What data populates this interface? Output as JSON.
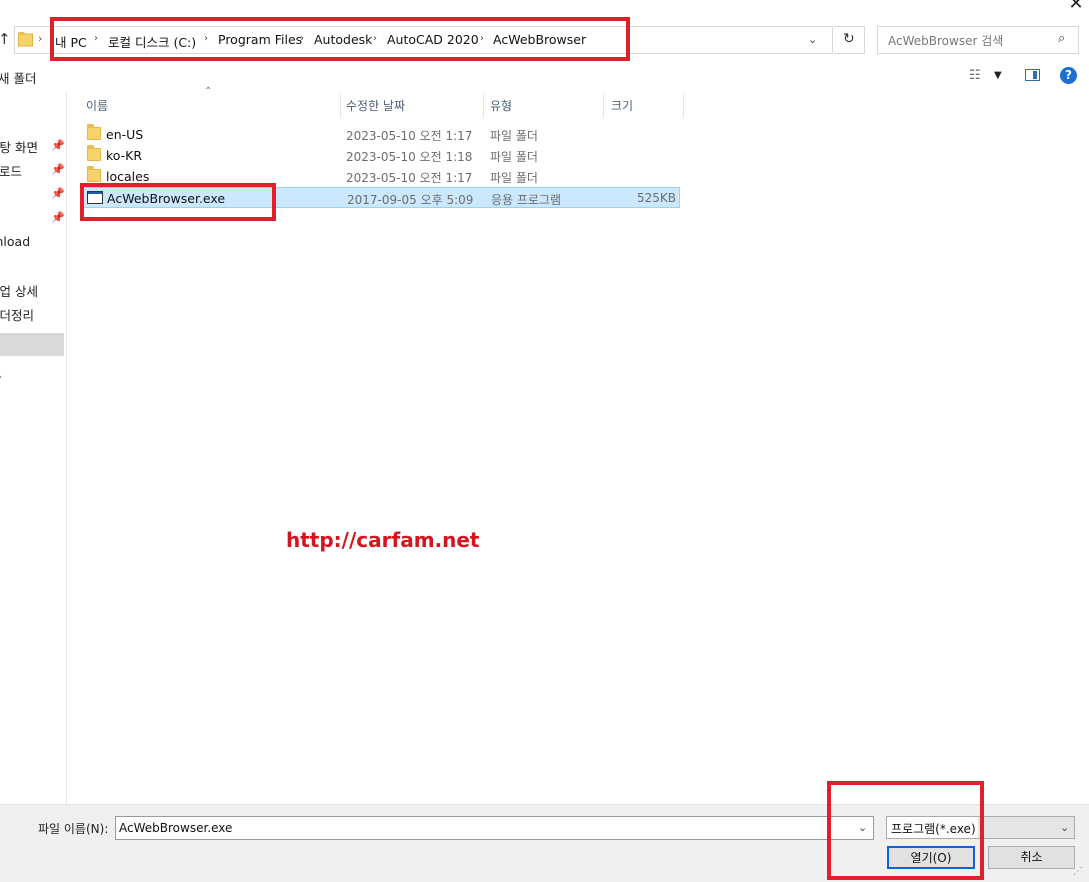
{
  "window": {
    "close_glyph": "✕"
  },
  "address_bar": {
    "breadcrumbs": [
      "내 PC",
      "로컬 디스크 (C:)",
      "Program Files",
      "Autodesk",
      "AutoCAD 2020",
      "AcWebBrowser"
    ],
    "search_placeholder": "AcWebBrowser 검색"
  },
  "toolbar": {
    "new_folder_label": "새 폴더"
  },
  "nav_pane": {
    "items": [
      "바탕 화면",
      "다운로드",
      "",
      "",
      "Download",
      "",
      "작업 상세",
      "폴더정리"
    ]
  },
  "columns": {
    "name": "이름",
    "modified": "수정한 날짜",
    "type": "유형",
    "size": "크기"
  },
  "files": [
    {
      "name": "en-US",
      "modified": "2023-05-10 오전 1:17",
      "type": "파일 폴더",
      "size": "",
      "icon": "folder-icon"
    },
    {
      "name": "ko-KR",
      "modified": "2023-05-10 오전 1:18",
      "type": "파일 폴더",
      "size": "",
      "icon": "folder-icon"
    },
    {
      "name": "locales",
      "modified": "2023-05-10 오전 1:17",
      "type": "파일 폴더",
      "size": "",
      "icon": "folder-icon"
    },
    {
      "name": "AcWebBrowser.exe",
      "modified": "2017-09-05 오후 5:09",
      "type": "응용 프로그램",
      "size": "525KB",
      "icon": "exe-icon",
      "selected": true
    }
  ],
  "watermark": "http://carfam.net",
  "bottom": {
    "filename_label": "파일 이름(N):",
    "filename_value": "AcWebBrowser.exe",
    "filter_value": "프로그램(*.exe)",
    "open_button": "열기(O)",
    "cancel_button": "취소"
  },
  "colors": {
    "highlight_red": "#e0202a",
    "selection": "#cce8ff",
    "accent": "#0a64d8"
  }
}
